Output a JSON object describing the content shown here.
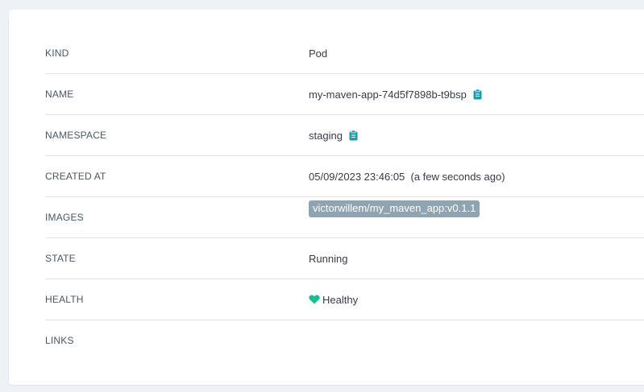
{
  "colors": {
    "accent": "#1d9bb0",
    "health_green": "#18be94",
    "tag_bg": "#8fa4b1"
  },
  "rows": [
    {
      "key": "KIND",
      "value": "Pod"
    },
    {
      "key": "NAME",
      "value": "my-maven-app-74d5f7898b-t9bsp",
      "icon": "clipboard-icon"
    },
    {
      "key": "NAMESPACE",
      "value": "staging",
      "icon": "clipboard-icon"
    },
    {
      "key": "CREATED AT",
      "value": "05/09/2023 23:46:05  (a few seconds ago)"
    },
    {
      "key": "IMAGES",
      "value": "victorwillem/my_maven_app:v0.1.1"
    },
    {
      "key": "STATE",
      "value": "Running"
    },
    {
      "key": "HEALTH",
      "value": "Healthy",
      "icon": "heart-icon"
    },
    {
      "key": "LINKS",
      "value": ""
    }
  ]
}
